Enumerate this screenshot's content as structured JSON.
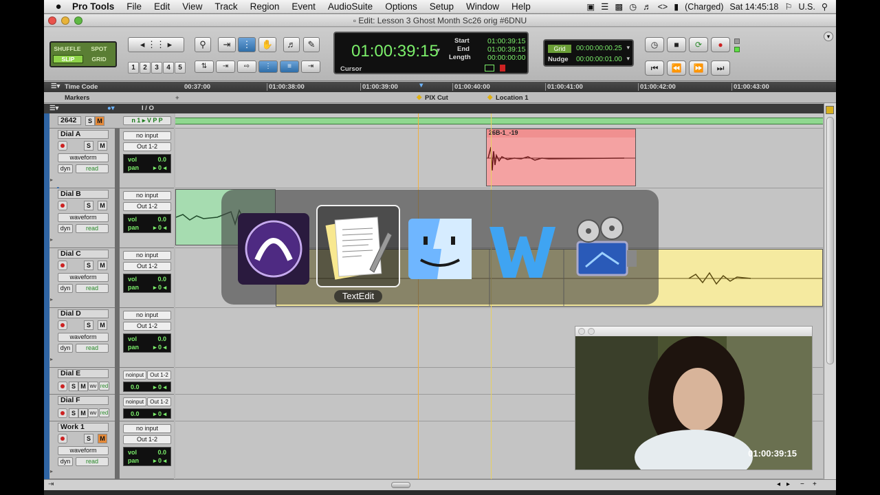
{
  "menubar": {
    "apple": "",
    "items": [
      "Pro Tools",
      "File",
      "Edit",
      "View",
      "Track",
      "Region",
      "Event",
      "AudioSuite",
      "Options",
      "Setup",
      "Window",
      "Help"
    ],
    "battery": "(Charged)",
    "clock": "Sat 14:45:18",
    "input_source": "U.S."
  },
  "window": {
    "title": "Edit: Lesson 3 Ghost Month Sc26 orig #6DNU"
  },
  "toolbar": {
    "modes": {
      "shuffle": "SHUFFLE",
      "spot": "SPOT",
      "slip": "SLIP",
      "grid": "GRID"
    },
    "zoom_presets": [
      "1",
      "2",
      "3",
      "4",
      "5"
    ],
    "counter": {
      "main": "01:00:39:15",
      "start_label": "Start",
      "start": "01:00:39:15",
      "end_label": "End",
      "end": "01:00:39:15",
      "length_label": "Length",
      "length": "00:00:00:00",
      "cursor_label": "Cursor"
    },
    "grid": {
      "grid_label": "Grid",
      "grid_value": "00:00:00:00.25",
      "nudge_label": "Nudge",
      "nudge_value": "00:00:00:01.00"
    }
  },
  "ruler": {
    "label": "Time Code",
    "ticks": [
      "00:37:00",
      "01:00:38:00",
      "01:00:39:00",
      "01:00:40:00",
      "01:00:41:00",
      "01:00:42:00",
      "01:00:43:00"
    ]
  },
  "markers": {
    "label": "Markers",
    "items": [
      "PIX Cut",
      "Location 1"
    ]
  },
  "header": {
    "io": "I / O"
  },
  "tracks": [
    {
      "name": "2642",
      "type": "video"
    },
    {
      "name": "Dial A",
      "input": "no input",
      "output": "Out 1-2",
      "view": "waveform",
      "dyn": "dyn",
      "auto": "read",
      "vol_label": "vol",
      "vol": "0.0",
      "pan_label": "pan",
      "pan": "▸ 0 ◂"
    },
    {
      "name": "Dial B",
      "input": "no input",
      "output": "Out 1-2",
      "view": "waveform",
      "dyn": "dyn",
      "auto": "read",
      "vol_label": "vol",
      "vol": "0.0",
      "pan_label": "pan",
      "pan": "▸ 0 ◂"
    },
    {
      "name": "Dial C",
      "input": "no input",
      "output": "Out 1-2",
      "view": "waveform",
      "dyn": "dyn",
      "auto": "read",
      "vol_label": "vol",
      "vol": "0.0",
      "pan_label": "pan",
      "pan": "▸ 0 ◂"
    },
    {
      "name": "Dial D",
      "input": "no input",
      "output": "Out 1-2",
      "view": "waveform",
      "dyn": "dyn",
      "auto": "read",
      "vol_label": "vol",
      "vol": "0.0",
      "pan_label": "pan",
      "pan": "▸ 0 ◂"
    },
    {
      "name": "Dial E",
      "input": "noinput",
      "output": "Out 1-2",
      "vol": "0.0",
      "pan": "▸ 0 ◂",
      "wv": "wv",
      "auto": "red"
    },
    {
      "name": "Dial F",
      "input": "noinput",
      "output": "Out 1-2",
      "vol": "0.0",
      "pan": "▸ 0 ◂",
      "wv": "wv",
      "auto": "red"
    },
    {
      "name": "Work 1",
      "input": "no input",
      "output": "Out 1-2",
      "view": "waveform",
      "dyn": "dyn",
      "auto": "read",
      "vol_label": "vol",
      "vol": "0.0",
      "pan_label": "pan",
      "pan": "▸ 0 ◂"
    }
  ],
  "clips": {
    "dial_a_clip": "26B-1_-19"
  },
  "app_switcher": {
    "apps": [
      "Pro Tools",
      "TextEdit",
      "Finder",
      "Word",
      "iMovie"
    ],
    "selected": "TextEdit"
  },
  "video_window": {
    "timecode": "01:00:39:15"
  },
  "colors": {
    "counter_green": "#7cf06b",
    "track_blue": "#2f64a3",
    "clip_red": "#f4a2a2",
    "clip_green": "#a6dcb0",
    "clip_yellow": "#f5eaa0"
  }
}
